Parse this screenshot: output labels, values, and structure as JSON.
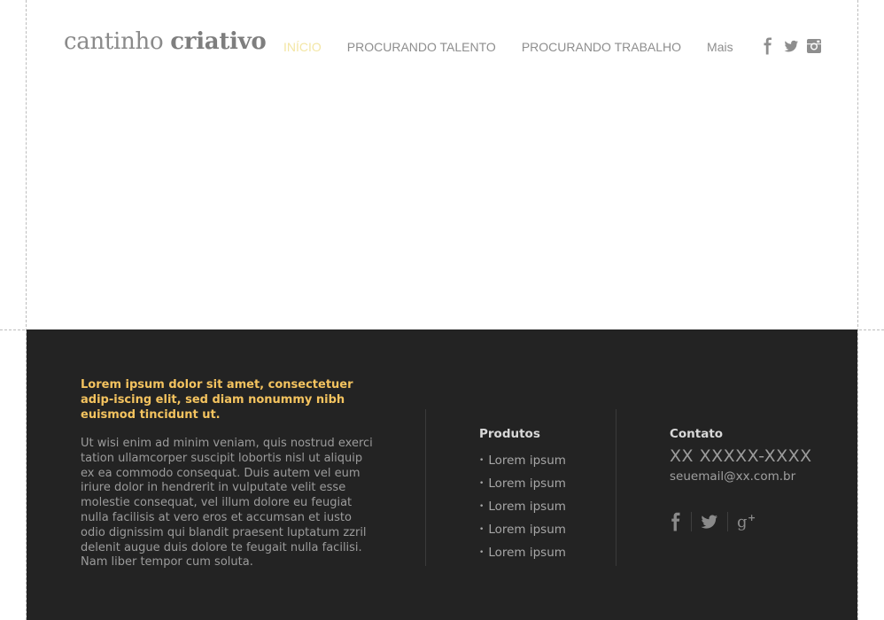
{
  "logo": {
    "light": "cantinho ",
    "bold": "criativo"
  },
  "nav": {
    "items": [
      {
        "label": "INÍCIO",
        "active": true
      },
      {
        "label": "PROCURANDO TALENTO",
        "active": false
      },
      {
        "label": "PROCURANDO TRABALHO",
        "active": false
      },
      {
        "label": "Mais",
        "active": false
      }
    ]
  },
  "social_top": {
    "icons": [
      "facebook-icon",
      "twitter-icon",
      "instagram-icon"
    ]
  },
  "footer": {
    "headline": "Lorem ipsum dolor sit amet, consectetuer adip-iscing elit, sed diam nonummy nibh euismod tincidunt ut.",
    "body": "Ut wisi enim ad minim veniam, quis nostrud exerci tation ullamcorper suscipit lobortis nisl ut aliquip ex ea commodo consequat. Duis autem vel eum iriure dolor in hendrerit in vulputate velit esse molestie consequat, vel illum dolore eu feugiat nulla facilisis at vero eros et accumsan et iusto odio dignissim qui blandit praesent luptatum zzril delenit augue duis dolore te feugait nulla facilisi. Nam liber tempor cum soluta.",
    "products": {
      "title": "Produtos",
      "items": [
        "Lorem ipsum",
        "Lorem ipsum",
        "Lorem ipsum",
        "Lorem ipsum",
        "Lorem ipsum"
      ]
    },
    "contact": {
      "title": "Contato",
      "phone": "XX XXXXX-XXXX",
      "email": "seuemail@xx.com.br"
    },
    "social_icons": [
      "facebook-icon",
      "twitter-icon",
      "google-plus-icon"
    ]
  },
  "colors": {
    "accent": "#f4c35f",
    "nav_active": "#f3e6a4",
    "footer_bg": "#232323"
  }
}
